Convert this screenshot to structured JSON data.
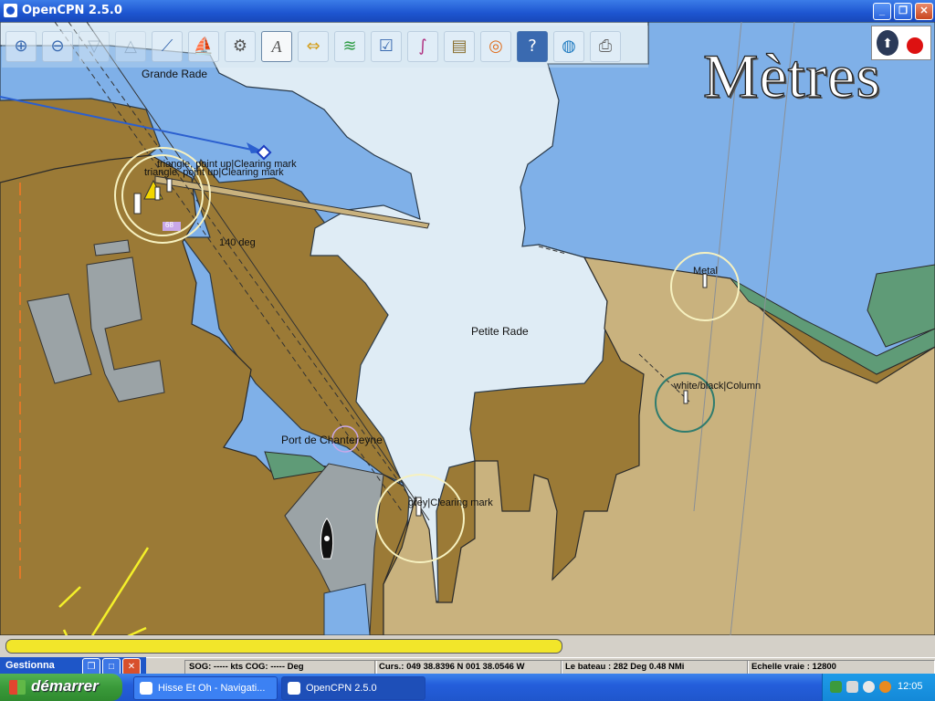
{
  "window": {
    "title": "OpenCPN 2.5.0",
    "buttons": [
      "_",
      "❐",
      "✕"
    ]
  },
  "toolbar": {
    "tools": [
      {
        "name": "zoom-in-icon",
        "glyph": "⊕"
      },
      {
        "name": "zoom-out-icon",
        "glyph": "⊖"
      },
      {
        "name": "scale-in-icon",
        "glyph": "▽"
      },
      {
        "name": "scale-out-icon",
        "glyph": "△"
      },
      {
        "name": "route-icon",
        "glyph": "⟋"
      },
      {
        "name": "auto-follow-icon",
        "glyph": "⛵"
      },
      {
        "name": "settings-icon",
        "glyph": "⚙"
      },
      {
        "name": "text-icon",
        "glyph": "A"
      },
      {
        "name": "current-icon",
        "glyph": "⇔"
      },
      {
        "name": "tide-icon",
        "glyph": "≋"
      },
      {
        "name": "route-manager-icon",
        "glyph": "☑"
      },
      {
        "name": "track-icon",
        "glyph": "∫"
      },
      {
        "name": "color-scheme-icon",
        "glyph": "▤"
      },
      {
        "name": "man-overboard-icon",
        "glyph": "◎"
      },
      {
        "name": "help-icon",
        "glyph": "?"
      },
      {
        "name": "globe-icon",
        "glyph": "◍"
      },
      {
        "name": "print-icon",
        "glyph": "⎙"
      }
    ]
  },
  "units_label": "Mètres",
  "place_names": {
    "grande_rade": "Grande Rade",
    "petite_rade": "Petite Rade",
    "port": "Port de Chantereyne"
  },
  "objects": {
    "clearing1": "triangle, point up|Clearing mark",
    "clearing2": "triangle, point up|Clearing mark",
    "bearing": "140 deg",
    "metal": "Metal",
    "column": "white/black|Column",
    "grey_clearing": "grey|Clearing mark",
    "depth_tag": "68"
  },
  "progress": {
    "fraction": 1.0
  },
  "status": {
    "sog_cog": "SOG: ----- kts  COG: ----- Deg",
    "position": "Curs.: 049 38.8396 N 001 38.0546 W",
    "bearing": "Le bateau : 282 Deg   0.48 NMi",
    "scale": "Echelle vraie :   12800"
  },
  "mini_panel": {
    "label": "Gestionna"
  },
  "taskbar": {
    "start": "démarrer",
    "tasks": [
      "Hisse Et Oh - Navigati...",
      "OpenCPN 2.5.0"
    ],
    "clock": "12:05"
  },
  "colors": {
    "land": "#9b7a36",
    "built_land": "#c9b27e",
    "deep_water": "#7fb0e8",
    "shallow_water": "#dfecf5",
    "buildings": "#9ba3a6",
    "green_shore": "#5f9b77"
  }
}
